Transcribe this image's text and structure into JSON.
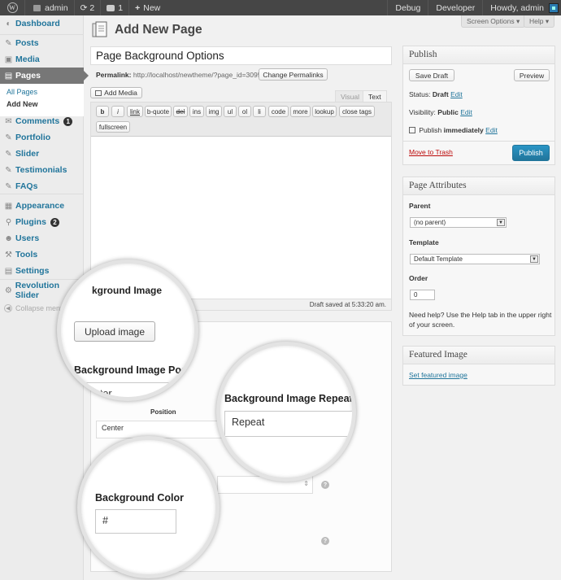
{
  "adminbar": {
    "site": "admin",
    "updates": "2",
    "comments": "1",
    "new": "New",
    "debug": "Debug",
    "developer": "Developer",
    "howdy": "Howdy, admin"
  },
  "sidebar": {
    "dashboard": "Dashboard",
    "posts": "Posts",
    "media": "Media",
    "pages": "Pages",
    "all_pages": "All Pages",
    "add_new": "Add New",
    "comments": "Comments",
    "comments_count": "1",
    "portfolio": "Portfolio",
    "slider": "Slider",
    "testimonials": "Testimonials",
    "faqs": "FAQs",
    "appearance": "Appearance",
    "plugins": "Plugins",
    "plugins_count": "2",
    "users": "Users",
    "tools": "Tools",
    "settings": "Settings",
    "revolution": "Revolution Slider",
    "collapse": "Collapse menu"
  },
  "header": {
    "title": "Add New Page",
    "screen_options": "Screen Options ▾",
    "help": "Help ▾"
  },
  "editor": {
    "post_title": "Page Background Options",
    "permalink_label": "Permalink:",
    "permalink_url": "http://localhost/newtheme/?page_id=3095",
    "change_permalinks": "Change Permalinks",
    "add_media": "Add Media",
    "visual_tab": "Visual",
    "text_tab": "Text",
    "quicktags": [
      "b",
      "i",
      "link",
      "b-quote",
      "del",
      "ins",
      "img",
      "ul",
      "ol",
      "li",
      "code",
      "more",
      "lookup",
      "close tags",
      "fullscreen"
    ],
    "draft_saved": "Draft saved at 5:33:20 am."
  },
  "meta_box": {
    "position_label_fragment": "Position",
    "position_value": "Center"
  },
  "publish": {
    "title": "Publish",
    "save_draft": "Save Draft",
    "preview": "Preview",
    "status_label": "Status:",
    "status_value": "Draft",
    "visibility_label": "Visibility:",
    "visibility_value": "Public",
    "publish_label": "Publish",
    "publish_value": "immediately",
    "edit": "Edit",
    "move_to_trash": "Move to Trash",
    "publish_button": "Publish"
  },
  "page_attributes": {
    "title": "Page Attributes",
    "parent_label": "Parent",
    "parent_value": "(no parent)",
    "template_label": "Template",
    "template_value": "Default Template",
    "order_label": "Order",
    "order_value": "0",
    "help_text": "Need help? Use the Help tab in the upper right of your screen."
  },
  "featured_image": {
    "title": "Featured Image",
    "set_link": "Set featured image"
  },
  "loupes": {
    "one": {
      "heading_fragment": "kground Image",
      "upload_button": "Upload image",
      "position_label_fragment": "Background Image Positi",
      "position_value": "Center"
    },
    "two": {
      "label": "Background Image Repeat",
      "value": "Repeat"
    },
    "three": {
      "label": "Background Color",
      "value": "#"
    }
  }
}
